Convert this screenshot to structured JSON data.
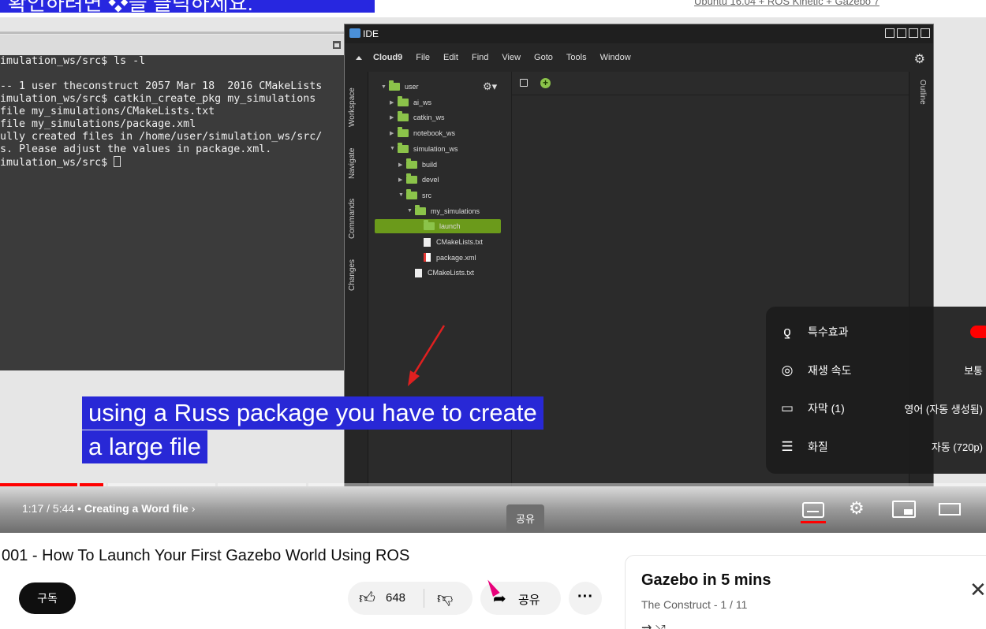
{
  "slide": {
    "banner_text": "확인하려면 ❖을 클릭하세요.",
    "top_right_text": "Ubuntu 16.04 + ROS Kinetic + Gazebo 7"
  },
  "terminal": {
    "lines": [
      "imulation_ws/src$ ls -l",
      "",
      "-- 1 user theconstruct 2057 Mar 18  2016 CMakeLists",
      "imulation_ws/src$ catkin_create_pkg my_simulations",
      "file my_simulations/CMakeLists.txt",
      "file my_simulations/package.xml",
      "ully created files in /home/user/simulation_ws/src/",
      "s. Please adjust the values in package.xml.",
      "imulation_ws/src$ "
    ]
  },
  "ide": {
    "title": "IDE",
    "menu": [
      "Cloud9",
      "File",
      "Edit",
      "Find",
      "View",
      "Goto",
      "Tools",
      "Window"
    ],
    "side_tabs": [
      "Workspace",
      "Navigate",
      "Commands",
      "Changes"
    ],
    "outline_tab": "Outline",
    "tree": [
      {
        "label": "user",
        "type": "folder",
        "open": true
      },
      {
        "label": "ai_ws",
        "type": "folder",
        "open": false
      },
      {
        "label": "catkin_ws",
        "type": "folder",
        "open": false
      },
      {
        "label": "notebook_ws",
        "type": "folder",
        "open": false
      },
      {
        "label": "simulation_ws",
        "type": "folder",
        "open": true
      },
      {
        "label": "build",
        "type": "folder",
        "open": false
      },
      {
        "label": "devel",
        "type": "folder",
        "open": false
      },
      {
        "label": "src",
        "type": "folder",
        "open": true
      },
      {
        "label": "my_simulations",
        "type": "folder",
        "open": true
      },
      {
        "label": "launch",
        "type": "folder",
        "open": false,
        "selected": true
      },
      {
        "label": "CMakeLists.txt",
        "type": "file"
      },
      {
        "label": "package.xml",
        "type": "xml"
      },
      {
        "label": "CMakeLists.txt",
        "type": "file"
      }
    ]
  },
  "subtitle": {
    "line1": "using a Russ package you have to create",
    "line2": "a large file"
  },
  "settings_menu": {
    "items": [
      {
        "icon": "special-effects-icon",
        "label": "특수효과",
        "value": ""
      },
      {
        "icon": "playback-speed-icon",
        "label": "재생 속도",
        "value": "보통"
      },
      {
        "icon": "subtitles-icon",
        "label": "자막 (1)",
        "value": "영어 (자동 생성됨)"
      },
      {
        "icon": "quality-icon",
        "label": "화질",
        "value": "자동 (720p)"
      }
    ]
  },
  "player": {
    "time": "1:17 / 5:44",
    "chapter": "Creating a Word file",
    "share_tooltip": "공유",
    "progress": 0.105,
    "accent": "#ff0000"
  },
  "video": {
    "title": "001 - How To Launch Your First Gazebo World Using ROS",
    "subscribe_label": "구독",
    "like_count": "648",
    "share_label": "공유",
    "more_label": "···"
  },
  "playlist": {
    "title": "Gazebo in 5 mins",
    "subtitle": "The Construct - 1 / 11"
  }
}
